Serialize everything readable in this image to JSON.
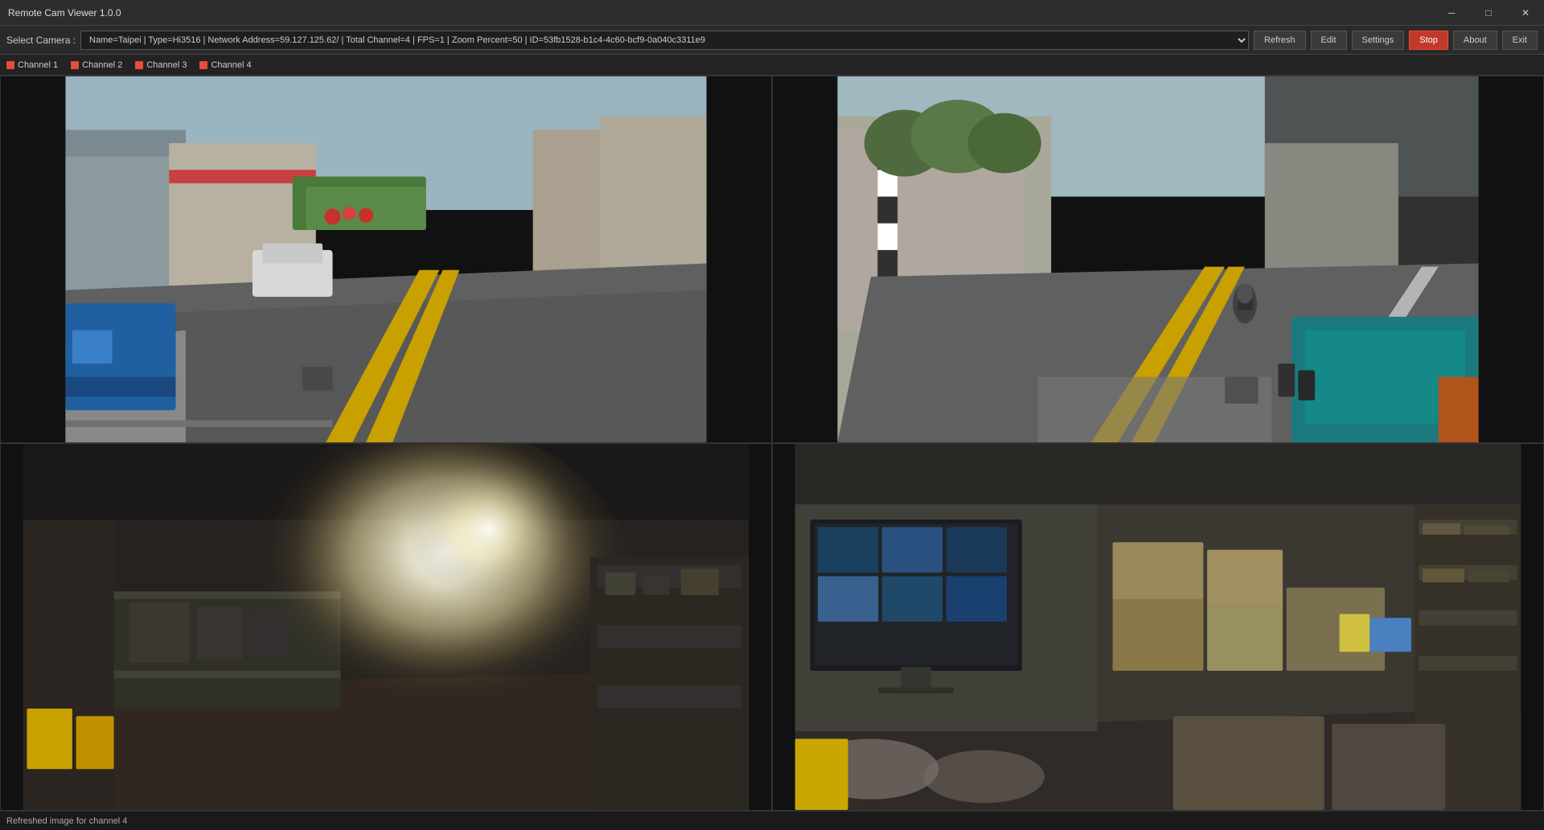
{
  "app": {
    "title": "Remote Cam Viewer 1.0.0"
  },
  "win_controls": {
    "minimize": "─",
    "maximize": "□",
    "close": "✕"
  },
  "toolbar": {
    "camera_label": "Select Camera :",
    "camera_value": "Name=Taipei | Type=Hi3516 | Network Address=59.127.125.62/ | Total Channel=4 | FPS=1 | Zoom Percent=50 | ID=53fb1528-b1c4-4c60-bcf9-0a040c3311e9",
    "refresh_label": "Refresh",
    "edit_label": "Edit",
    "settings_label": "Settings",
    "stop_label": "Stop",
    "about_label": "About",
    "exit_label": "Exit"
  },
  "channels": [
    {
      "label": "Channel 1"
    },
    {
      "label": "Channel 2"
    },
    {
      "label": "Channel 3"
    },
    {
      "label": "Channel 4"
    }
  ],
  "status": {
    "message": "Refreshed image for channel 4"
  }
}
